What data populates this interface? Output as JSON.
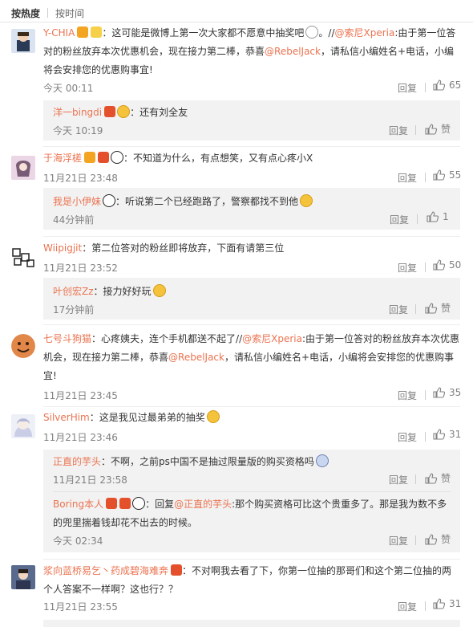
{
  "sort": {
    "hot": "按热度",
    "time": "按时间"
  },
  "labels": {
    "reply": "回复",
    "like": "赞",
    "colon": "："
  },
  "colors": {
    "link": "#eb7350",
    "meta": "#808080",
    "sub_bg": "#f2f2f2"
  },
  "comments": [
    {
      "user": "Y-CHIA",
      "pre": "这可能是微博上第一次大家都不愿意中抽奖吧",
      "after_emoji": "。//",
      "at1": "@索尼Xperia",
      "mid": ":由于第一位答对的粉丝放弃本次优惠机会，现在接力第二棒，恭喜",
      "at2": "@RebelJack",
      "post": "，请私信小编姓名+电话，小编将会安排您的优惠购事宜!",
      "time": "今天 00:11",
      "likes": "65",
      "replies": [
        {
          "user": "洋一bingdi",
          "text": "还有刘全友",
          "time": "今天 10:19",
          "likes": "赞"
        }
      ]
    },
    {
      "user": "于海浮槎",
      "text": "不知道为什么，有点想笑，又有点心疼小X",
      "time": "11月21日 23:48",
      "likes": "55",
      "replies": [
        {
          "user": "我是小伊妹",
          "text": "听说第二个已经跑路了，警察都找不到他",
          "time": "44分钟前",
          "likes": "1"
        }
      ]
    },
    {
      "user": "Wiipigjit",
      "text": "第二位答对的粉丝即将放弃，下面有请第三位",
      "time": "11月21日 23:52",
      "likes": "50",
      "replies": [
        {
          "user": "叶创宏Zz",
          "text": "接力好好玩",
          "time": "17分钟前",
          "likes": "赞"
        }
      ]
    },
    {
      "user": "七号斗狗猫",
      "pre": "心疼姨夫，连个手机都送不起了//",
      "at1": "@索尼Xperia",
      "mid": ":由于第一位答对的粉丝放弃本次优惠机会，现在接力第二棒，恭喜",
      "at2": "@RebelJack",
      "post": "，请私信小编姓名+电话，小编将会安排您的优惠购事宜!",
      "time": "11月21日 23:45",
      "likes": "35"
    },
    {
      "user": "SilverHim",
      "text": "这是我见过最弟弟的抽奖",
      "time": "11月21日 23:46",
      "likes": "31",
      "replies": [
        {
          "user": "正直的芋头",
          "text": "不啊，之前ps中国不是抽过限量版的购买资格吗",
          "time": "11月21日 23:58",
          "likes": "赞"
        },
        {
          "user": "Boring本人",
          "pre": "回复",
          "at": "@正直的芋头",
          "text": ":那个购买资格可比这个贵重多了。那是我为数不多的兜里揣着钱却花不出去的时候。",
          "time": "今天 02:34",
          "likes": "赞"
        }
      ]
    },
    {
      "user": "浆向蓝桥易乞丶药成碧海难奔",
      "text": "不对啊我去看了下，你第一位抽的那哥们和这个第二位抽的两个人答案不一样啊？这也行？？",
      "time": "11月21日 23:55",
      "likes": "31"
    }
  ]
}
